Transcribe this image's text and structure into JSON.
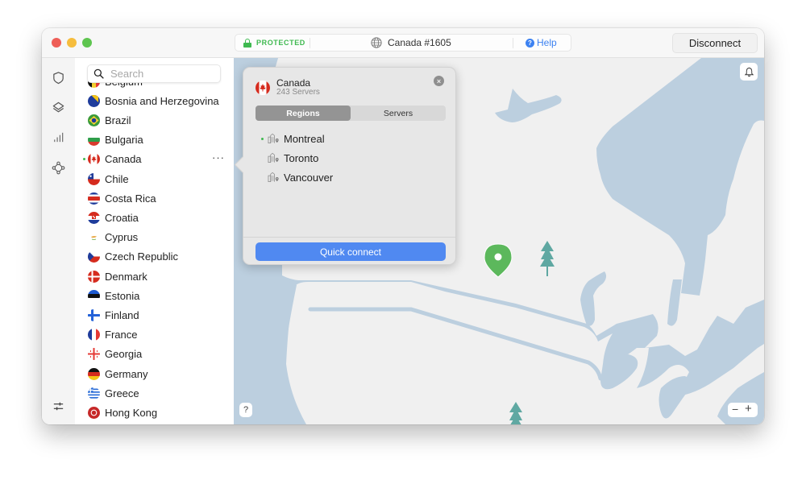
{
  "window": {
    "status": {
      "label": "PROTECTED",
      "color": "#3fb950"
    },
    "server": {
      "label": "Canada #1605",
      "icon": "globe-icon"
    },
    "help": {
      "label": "Help",
      "icon": "question-circle-icon",
      "color": "#3d82f1"
    },
    "disconnect_label": "Disconnect"
  },
  "rail": {
    "items": [
      {
        "name": "shield-icon"
      },
      {
        "name": "layers-icon"
      },
      {
        "name": "stats-icon"
      },
      {
        "name": "meshnet-icon"
      }
    ],
    "bottom": {
      "name": "settings-sliders-icon"
    }
  },
  "search": {
    "placeholder": "Search",
    "value": ""
  },
  "countries": [
    {
      "name": "Belgium",
      "flag": "be"
    },
    {
      "name": "Bosnia and Herzegovina",
      "flag": "ba"
    },
    {
      "name": "Brazil",
      "flag": "br"
    },
    {
      "name": "Bulgaria",
      "flag": "bg"
    },
    {
      "name": "Canada",
      "flag": "ca",
      "active": true,
      "more": "···"
    },
    {
      "name": "Chile",
      "flag": "cl"
    },
    {
      "name": "Costa Rica",
      "flag": "cr"
    },
    {
      "name": "Croatia",
      "flag": "hr"
    },
    {
      "name": "Cyprus",
      "flag": "cy"
    },
    {
      "name": "Czech Republic",
      "flag": "cz"
    },
    {
      "name": "Denmark",
      "flag": "dk"
    },
    {
      "name": "Estonia",
      "flag": "ee"
    },
    {
      "name": "Finland",
      "flag": "fi"
    },
    {
      "name": "France",
      "flag": "fr"
    },
    {
      "name": "Georgia",
      "flag": "ge"
    },
    {
      "name": "Germany",
      "flag": "de"
    },
    {
      "name": "Greece",
      "flag": "gr"
    },
    {
      "name": "Hong Kong",
      "flag": "hk"
    }
  ],
  "popover": {
    "country": "Canada",
    "servers": "243 Servers",
    "tabs": [
      {
        "label": "Regions",
        "active": true
      },
      {
        "label": "Servers",
        "active": false
      }
    ],
    "regions": [
      {
        "name": "Montreal",
        "active": true
      },
      {
        "name": "Toronto",
        "active": false
      },
      {
        "name": "Vancouver",
        "active": false
      }
    ],
    "quick_connect_label": "Quick connect",
    "close_icon": "×"
  },
  "map": {
    "help_label": "?",
    "zoom_out_label": "−",
    "zoom_in_label": "+",
    "water_color": "#bccfdf",
    "land_color": "#f0f0f0",
    "pin_color": "#5cb85c",
    "tree_color": "#5fa8a2"
  }
}
